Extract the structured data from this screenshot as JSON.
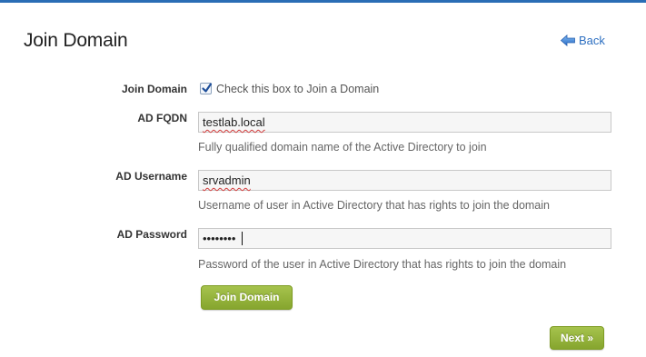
{
  "header": {
    "title": "Join Domain",
    "back_label": "Back",
    "back_icon": "arrow-left-icon"
  },
  "form": {
    "join_domain": {
      "label": "Join Domain",
      "checked": true,
      "checkbox_text": "Check this box to Join a Domain"
    },
    "ad_fqdn": {
      "label": "AD FQDN",
      "value": "testlab.local",
      "help": "Fully qualified domain name of the Active Directory to join"
    },
    "ad_username": {
      "label": "AD Username",
      "value": "srvadmin",
      "help": "Username of user in Active Directory that has rights to join the domain"
    },
    "ad_password": {
      "label": "AD Password",
      "masked_value": "••••••••",
      "help": "Password of the user in Active Directory that has rights to join the domain"
    },
    "submit_label": "Join Domain"
  },
  "footer": {
    "next_label": "Next »"
  },
  "colors": {
    "accent_blue": "#2d6fc1",
    "button_green": "#95b43b"
  }
}
